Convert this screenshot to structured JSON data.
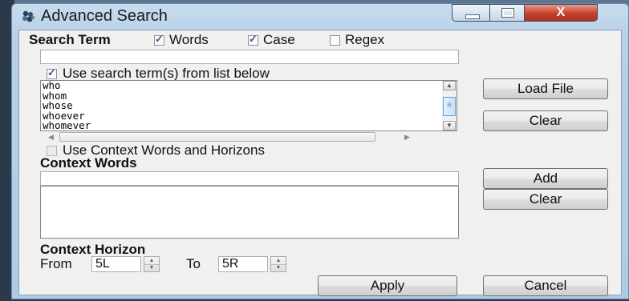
{
  "window": {
    "title": "Advanced Search",
    "controls": {
      "minimize": "—",
      "maximize": "□",
      "close": "X"
    }
  },
  "search_term": {
    "label": "Search Term",
    "words": {
      "label": "Words",
      "checked": true
    },
    "case": {
      "label": "Case",
      "checked": true
    },
    "regex": {
      "label": "Regex",
      "checked": false
    },
    "value": ""
  },
  "term_list": {
    "use_list_label": "Use search term(s) from list below",
    "use_list_checked": true,
    "items": [
      "who",
      "whom",
      "whose",
      "whoever",
      "whomever"
    ]
  },
  "buttons": {
    "load_file": "Load File",
    "clear_list": "Clear",
    "add": "Add",
    "clear_context": "Clear",
    "apply": "Apply",
    "cancel": "Cancel"
  },
  "context": {
    "use_context_label": "Use Context Words and Horizons",
    "use_context_checked": false,
    "words_label": "Context Words",
    "word_value": ""
  },
  "horizon": {
    "label": "Context Horizon",
    "from_label": "From",
    "from_value": "5L",
    "to_label": "To",
    "to_value": "5R"
  },
  "icons": {
    "app": "cluster-icon",
    "spin_up": "▲",
    "spin_down": "▼",
    "scroll_up": "▲",
    "scroll_down": "▼",
    "scroll_left": "◀",
    "scroll_right": "▶",
    "thumb_grip": "≡"
  }
}
